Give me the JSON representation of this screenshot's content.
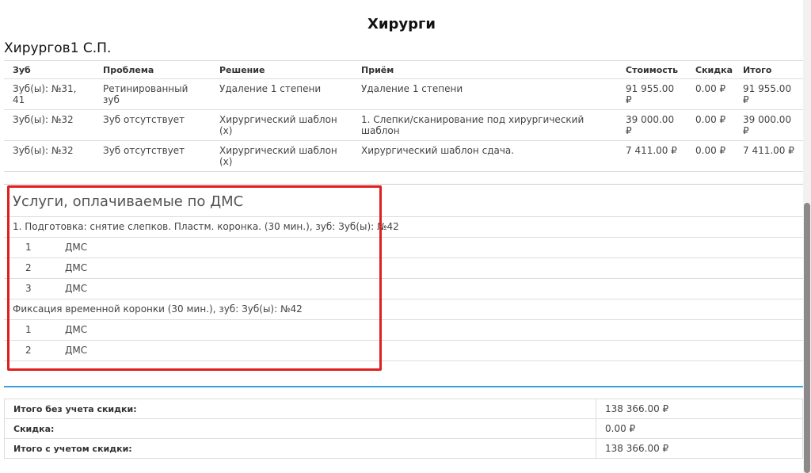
{
  "page_title": "Хирурги",
  "doctor_name": "Хирургов1 С.П.",
  "procedures": {
    "headers": [
      "Зуб",
      "Проблема",
      "Решение",
      "Приём",
      "Стоимость",
      "Скидка",
      "Итого"
    ],
    "rows": [
      [
        "Зуб(ы): №31, 41",
        "Ретинированный зуб",
        "Удаление 1 степени",
        "Удаление 1 степени",
        "91 955.00 ₽",
        "0.00 ₽",
        "91 955.00 ₽"
      ],
      [
        "Зуб(ы): №32",
        "Зуб отсутствует",
        "Хирургический шаблон (х)",
        "1. Слепки/сканирование под хирургический шаблон",
        "39 000.00 ₽",
        "0.00 ₽",
        "39 000.00 ₽"
      ],
      [
        "Зуб(ы): №32",
        "Зуб отсутствует",
        "Хирургический шаблон (х)",
        "Хирургический шаблон сдача.",
        "7 411.00 ₽",
        "0.00 ₽",
        "7 411.00 ₽"
      ]
    ]
  },
  "dms": {
    "title": "Услуги, оплачиваемые по ДМС",
    "groups": [
      {
        "label": "1. Подготовка: снятие слепков. Пластм. коронка. (30 мин.), зуб: Зуб(ы): №42",
        "items": [
          {
            "num": "1",
            "value": "ДМС"
          },
          {
            "num": "2",
            "value": "ДМС"
          },
          {
            "num": "3",
            "value": "ДМС"
          }
        ]
      },
      {
        "label": "Фиксация временной коронки (30 мин.), зуб: Зуб(ы): №42",
        "items": [
          {
            "num": "1",
            "value": "ДМС"
          },
          {
            "num": "2",
            "value": "ДМС"
          }
        ]
      }
    ]
  },
  "totals": [
    {
      "label": "Итого без учета скидки:",
      "value": "138 366.00 ₽"
    },
    {
      "label": "Скидка:",
      "value": "0.00 ₽"
    },
    {
      "label": "Итого с учетом скидки:",
      "value": "138 366.00 ₽"
    }
  ],
  "colors": {
    "highlight": "#e01e1e",
    "divider": "#3aa0d8"
  }
}
